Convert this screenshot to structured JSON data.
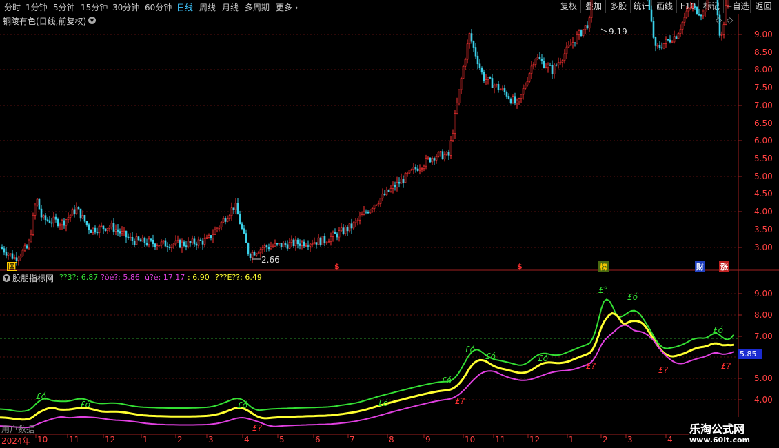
{
  "toolbar": {
    "periods": [
      "分时",
      "1分钟",
      "5分钟",
      "15分钟",
      "30分钟",
      "60分钟",
      "日线",
      "周线",
      "月线",
      "多周期",
      "更多"
    ],
    "right_buttons": [
      "复权",
      "叠加",
      "多股",
      "统计",
      "画线",
      "F10",
      "标记",
      "+自选",
      "返回"
    ]
  },
  "main_panel": {
    "title": "铜陵有色(日线,前复权)",
    "high_label": "9.19",
    "low_label": "2.66",
    "y_labels": [
      "9.00",
      "8.50",
      "8.00",
      "7.50",
      "7.00",
      "6.50",
      "6.00",
      "5.50",
      "5.00",
      "4.50",
      "4.00",
      "3.50",
      "3.00"
    ],
    "markers": {
      "reply": "回",
      "dollar": "$",
      "bang": "榜",
      "finance": "财",
      "up": "涨"
    }
  },
  "indicator_panel": {
    "title": "股朋指标网",
    "legend": [
      {
        "label": "??3?: 6.87",
        "color": "#34e034"
      },
      {
        "label": "?òè?: 5.86",
        "color": "#e040e0"
      },
      {
        "label": "ù?è: 17.17",
        "color": "#e040e0"
      },
      {
        "label": ": 6.90",
        "color": "#ffff30"
      },
      {
        "label": "???E??: 6.49",
        "color": "#ffff30"
      }
    ],
    "y_labels": [
      "9.00",
      "8.00",
      "7.00",
      "6.00",
      "5.00",
      "4.00"
    ],
    "current_value": "5.85",
    "bottom_left_text": "用户数据"
  },
  "x_axis": {
    "year_label": "2024年",
    "months": [
      "10",
      "11",
      "12",
      "1",
      "2",
      "3",
      "4",
      "5",
      "6",
      "7",
      "8",
      "9",
      "10",
      "11",
      "12",
      "1",
      "2",
      "3",
      "4"
    ]
  },
  "watermark": {
    "title": "乐淘公式网",
    "url": "www.60lt.com"
  }
}
